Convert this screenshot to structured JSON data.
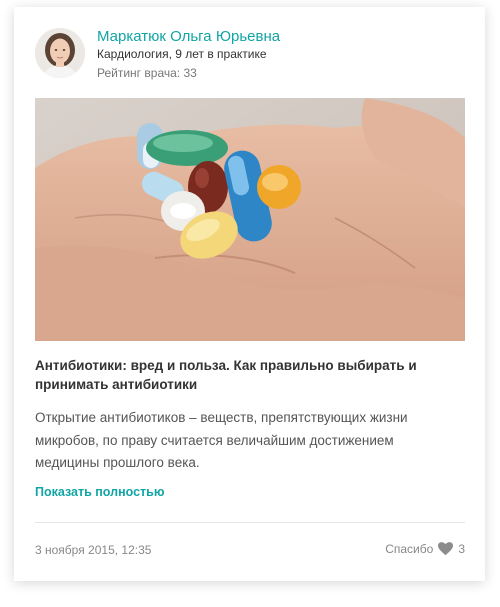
{
  "author": {
    "name": "Маркатюк Ольга Юрьевна",
    "specialty": "Кардиология, 9 лет в практике",
    "rating": "Рейтинг врача: 33"
  },
  "article": {
    "title": "Антибиотики: вред и польза. Как правильно выбирать и принимать антибиотики",
    "excerpt": "Открытие антибиотиков – веществ, препятствующих жизни микробов, по праву считается величайшим достижением медицины прошлого века.",
    "show_more": "Показать полностью"
  },
  "footer": {
    "date": "3 ноября 2015, 12:35",
    "thanks_label": "Спасибо",
    "thanks_count": "3"
  },
  "colors": {
    "accent": "#12a5a5",
    "heart": "#8c8c8c"
  },
  "icons": {
    "heart": "heart-icon"
  }
}
